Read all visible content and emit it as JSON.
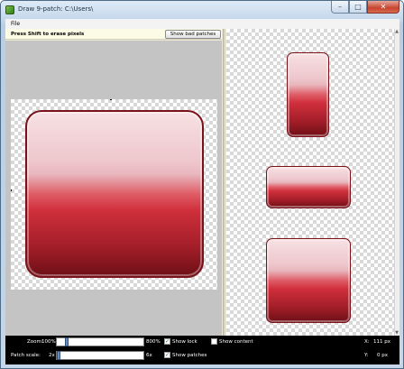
{
  "window": {
    "title": "Draw 9-patch: C:\\Users\\",
    "controls": {
      "minimize": "–",
      "maximize": "□",
      "close": "✕"
    }
  },
  "menu": {
    "file": "File"
  },
  "toolbar": {
    "hint": "Press Shift to erase pixels",
    "show_bad_patches": "Show bad patches"
  },
  "status": {
    "zoom_label": "Zoom:",
    "zoom_min": "100%",
    "zoom_max": "800%",
    "zoom_level": 0.1,
    "patch_label": "Patch scale:",
    "patch_min": "2x",
    "patch_max": "6x",
    "patch_level": 0.0,
    "show_lock": "Show lock",
    "show_lock_checked": true,
    "show_patches": "Show patches",
    "show_patches_checked": true,
    "show_content": "Show content",
    "show_content_checked": false,
    "x_label": "X:",
    "x_value": "111 px",
    "y_label": "Y:",
    "y_value": "0 px"
  },
  "icons": [
    "app-icon",
    "minimize-icon",
    "maximize-icon",
    "close-icon",
    "checkbox-icon"
  ],
  "colors": {
    "accent_red": "#cf2f3b",
    "dark_red": "#7a1018",
    "status_bg": "#000000"
  }
}
